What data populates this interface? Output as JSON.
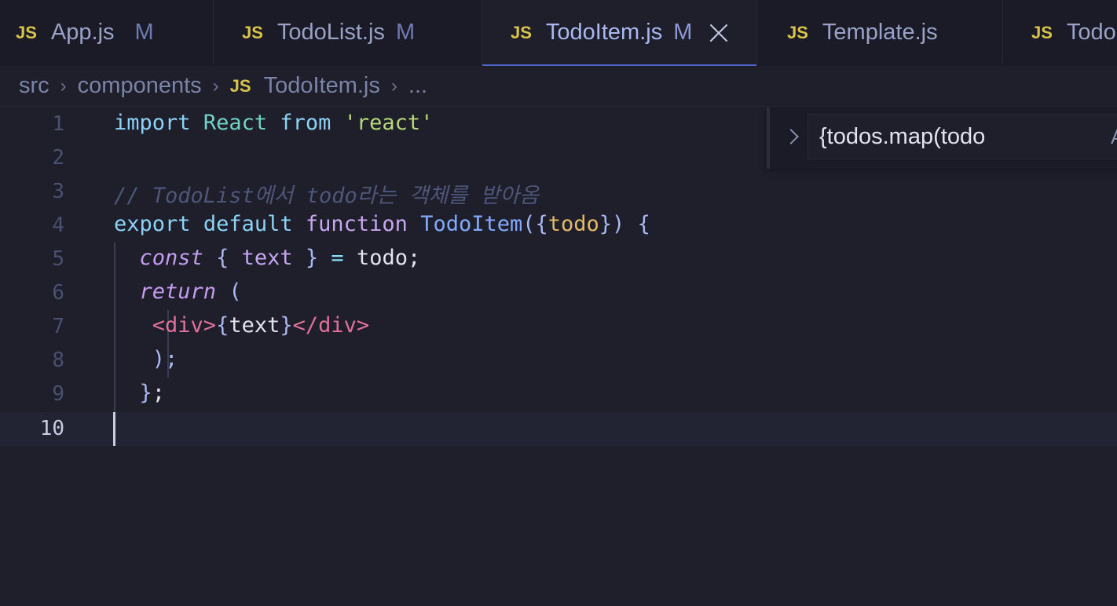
{
  "tabs": [
    {
      "icon": "JS",
      "label": "App.js",
      "modified": "M"
    },
    {
      "icon": "JS",
      "label": "TodoList.js",
      "modified": "M"
    },
    {
      "icon": "JS",
      "label": "TodoItem.js",
      "modified": "M"
    },
    {
      "icon": "JS",
      "label": "Template.js",
      "modified": ""
    },
    {
      "icon": "JS",
      "label": "Todo",
      "modified": ""
    }
  ],
  "breadcrumb": {
    "src": "src",
    "components": "components",
    "file_icon": "JS",
    "file": "TodoItem.js",
    "more": "..."
  },
  "line_numbers": [
    "1",
    "2",
    "3",
    "4",
    "5",
    "6",
    "7",
    "8",
    "9",
    "10"
  ],
  "code": {
    "l1": [
      "import",
      "React",
      "from",
      "'react'"
    ],
    "l3": "// TodoList에서 todo라는 객체를 받아옴",
    "l4": [
      "export",
      "default",
      "function",
      "TodoItem",
      "({",
      "todo",
      "})",
      "{"
    ],
    "l5": [
      "const",
      "{",
      "text",
      "}",
      "=",
      "todo;"
    ],
    "l6": [
      "return",
      "("
    ],
    "l7": [
      "<div>",
      "{",
      "text",
      "}",
      "</div>"
    ],
    "l8": ");",
    "l9": [
      "}",
      ";"
    ]
  },
  "find": {
    "value": "{todos.map(todo",
    "option": "A"
  },
  "colors": {
    "background": "#1e1f2b",
    "accent": "#4d63c9",
    "js_badge": "#d8c44a"
  }
}
